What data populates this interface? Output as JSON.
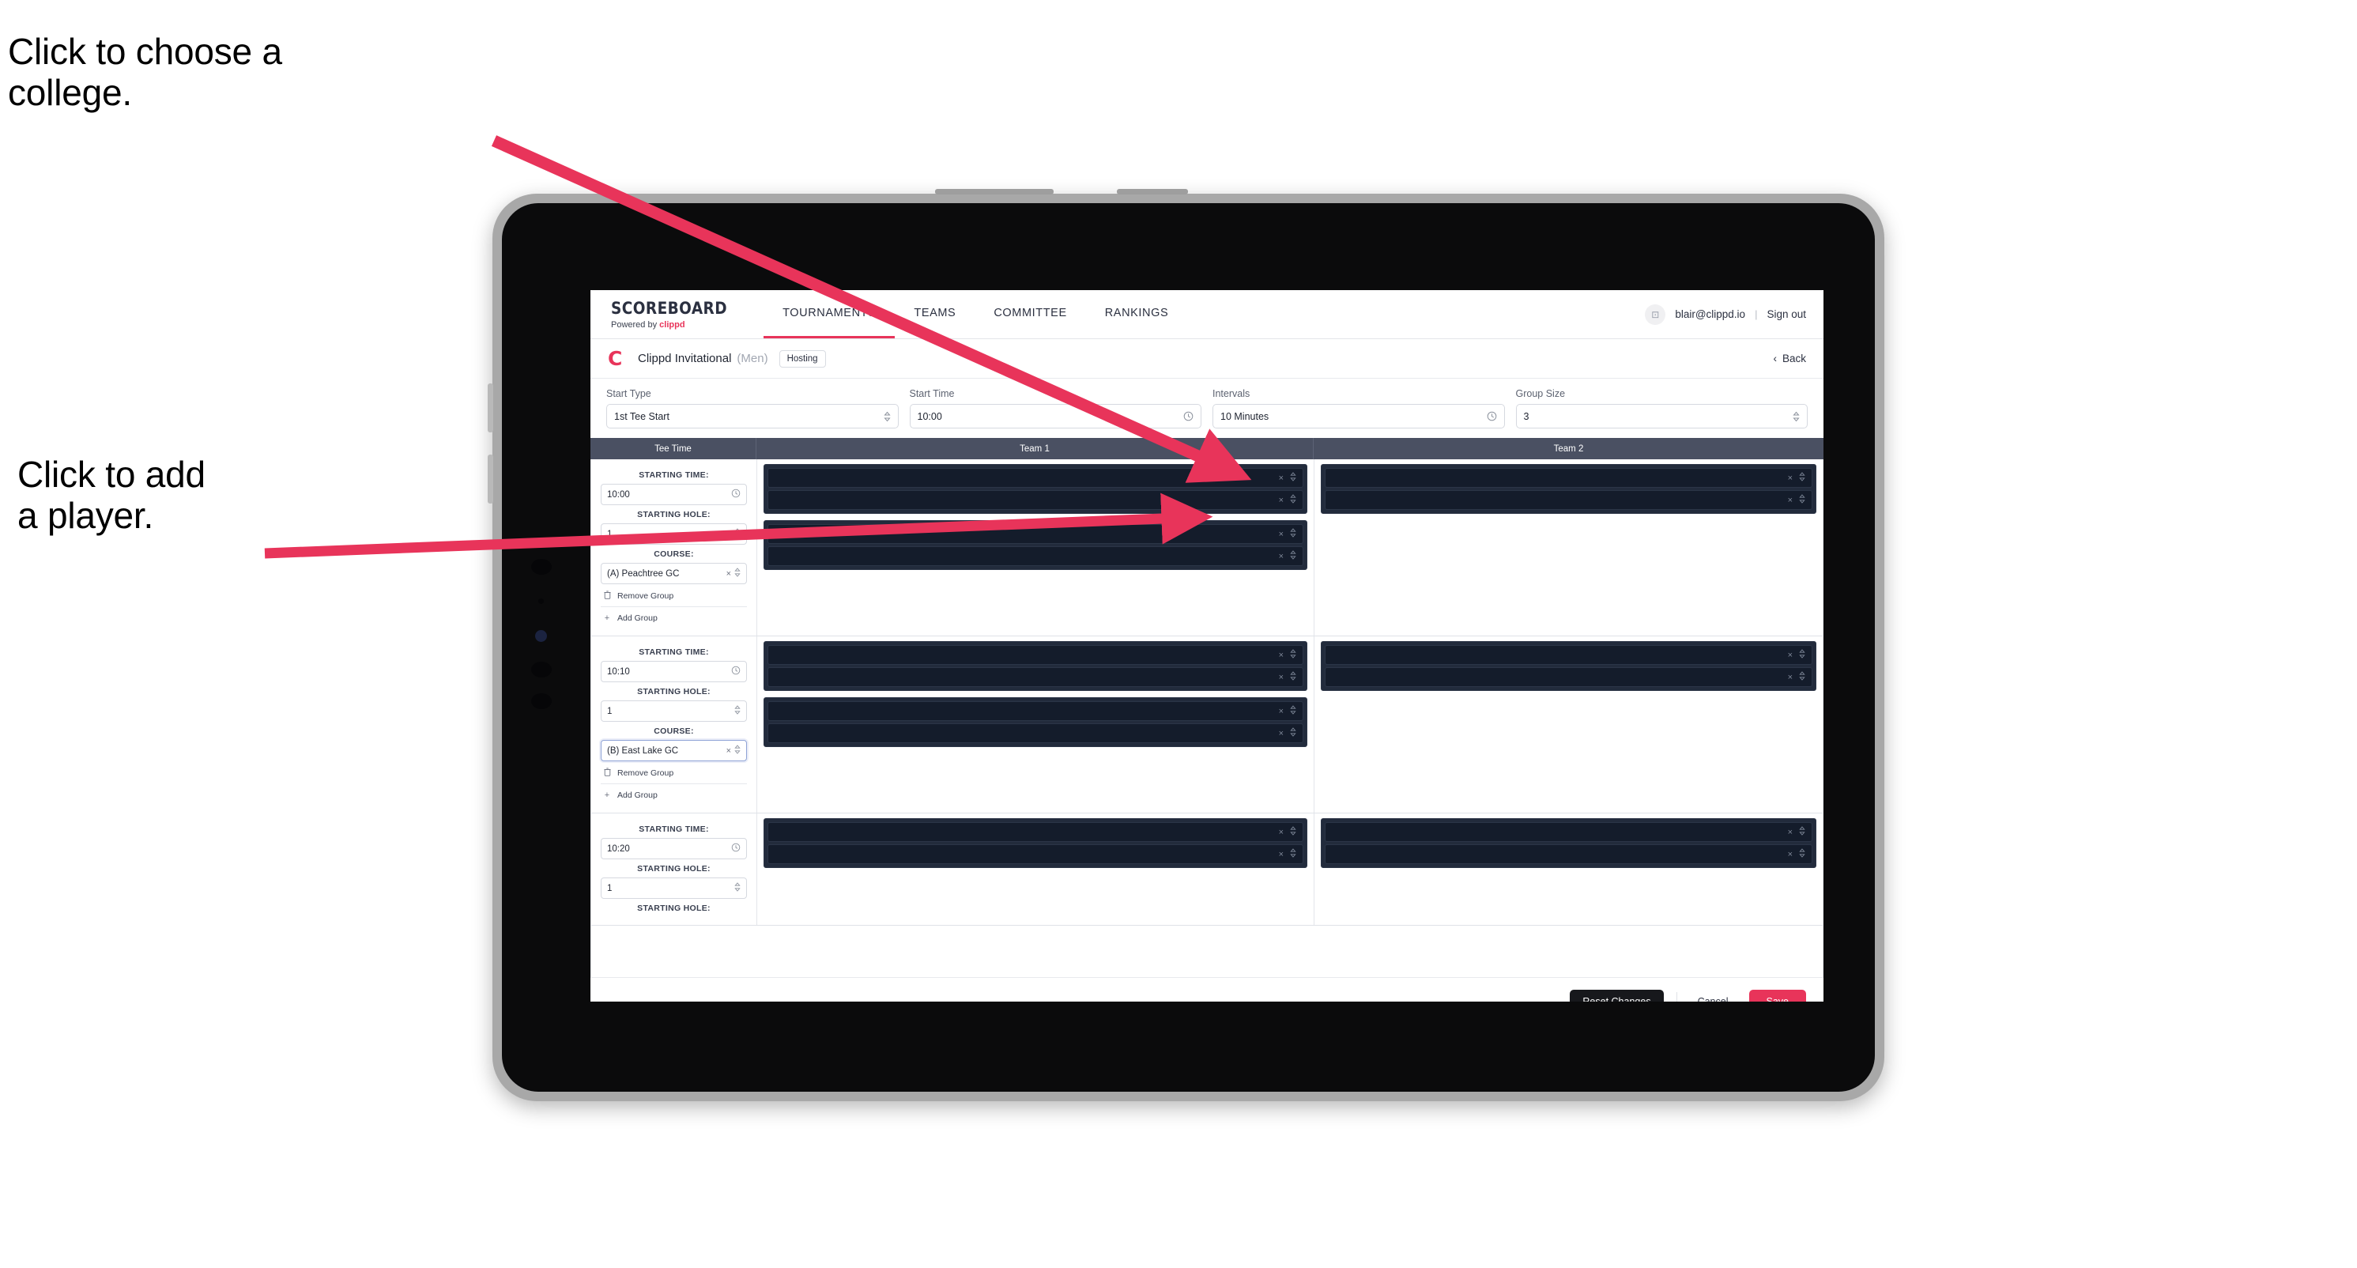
{
  "annotations": {
    "college": "Click to choose a\ncollege.",
    "player": "Click to add\na player."
  },
  "colors": {
    "accent_pink": "#e8345a",
    "header_slate": "#4a5062",
    "row_dark": "#141c2b",
    "group_dark": "#222b3c",
    "dark_button": "#17181c"
  },
  "topnav": {
    "brand_title": "SCOREBOARD",
    "brand_sub_prefix": "Powered by ",
    "brand_sub_brand": "clippd",
    "tabs": [
      {
        "label": "TOURNAMENTS",
        "active": true
      },
      {
        "label": "TEAMS",
        "active": false
      },
      {
        "label": "COMMITTEE",
        "active": false
      },
      {
        "label": "RANKINGS",
        "active": false
      }
    ],
    "account": {
      "avatar_glyph": "⊡",
      "email": "blair@clippd.io",
      "separator": "|",
      "sign_out": "Sign out"
    }
  },
  "tournament_bar": {
    "logo_glyph": "C",
    "name": "Clippd Invitational",
    "gender": "(Men)",
    "badge": "Hosting",
    "back_chevron": "‹",
    "back_label": "Back"
  },
  "controls": [
    {
      "label": "Start Type",
      "value": "1st Tee Start",
      "icon": "stepper-icon",
      "icon_glyph": "⌃⌄"
    },
    {
      "label": "Start Time",
      "value": "10:00",
      "icon": "clock-icon",
      "icon_glyph": "◴"
    },
    {
      "label": "Intervals",
      "value": "10 Minutes",
      "icon": "clock-icon",
      "icon_glyph": "◴"
    },
    {
      "label": "Group Size",
      "value": "3",
      "icon": "stepper-icon",
      "icon_glyph": "⌃⌄"
    }
  ],
  "table": {
    "headers": {
      "tee_time": "Tee Time",
      "team1": "Team 1",
      "team2": "Team 2"
    },
    "field_labels": {
      "starting_time": "STARTING TIME:",
      "starting_hole": "STARTING HOLE:",
      "course": "COURSE:"
    },
    "group_actions": {
      "remove": "Remove Group",
      "remove_icon_glyph": "☐",
      "add": "Add Group",
      "add_icon_glyph": "+"
    },
    "clear_glyph": "×",
    "stepper_glyph": "⇅",
    "rows": [
      {
        "starting_time": "10:00",
        "starting_hole": "1",
        "course": "(A) Peachtree GC",
        "course_focused": false,
        "team1_groups": [
          {
            "players": [
              "",
              ""
            ]
          },
          {
            "players": [
              "",
              ""
            ]
          }
        ],
        "team2_groups": [
          {
            "players": [
              "",
              ""
            ]
          }
        ]
      },
      {
        "starting_time": "10:10",
        "starting_hole": "1",
        "course": "(B) East Lake GC",
        "course_focused": true,
        "team1_groups": [
          {
            "players": [
              "",
              ""
            ]
          },
          {
            "players": [
              "",
              ""
            ]
          }
        ],
        "team2_groups": [
          {
            "players": [
              "",
              ""
            ]
          }
        ]
      },
      {
        "starting_time": "10:20",
        "starting_hole": "1",
        "course": "",
        "course_focused": false,
        "team1_groups": [
          {
            "players": [
              "",
              ""
            ]
          }
        ],
        "team2_groups": [
          {
            "players": [
              "",
              ""
            ]
          }
        ]
      }
    ]
  },
  "footer": {
    "reset": "Reset Changes",
    "cancel": "Cancel",
    "save": "Save"
  }
}
